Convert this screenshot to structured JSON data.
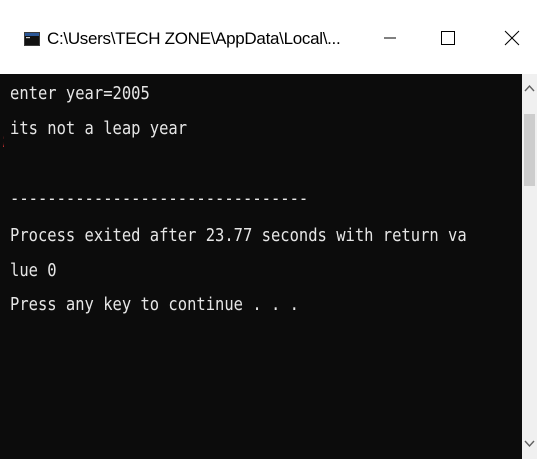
{
  "window": {
    "title": "C:\\Users\\TECH ZONE\\AppData\\Local\\..."
  },
  "console": {
    "lines": [
      "enter year=2005",
      "its not a leap year",
      "",
      "--------------------------------",
      "Process exited after 23.77 seconds with return va",
      "lue 0",
      "Press any key to continue . . ."
    ],
    "edge_mark": ";"
  },
  "colors": {
    "console_bg": "#0c0c0c",
    "console_text": "#e6e6e6",
    "titlebar_bg": "#ffffff"
  },
  "icons": {
    "app": "console-app-icon",
    "minimize": "minimize-icon",
    "maximize": "maximize-icon",
    "close": "close-icon",
    "scroll_up": "chevron-up-icon",
    "scroll_down": "chevron-down-icon"
  }
}
